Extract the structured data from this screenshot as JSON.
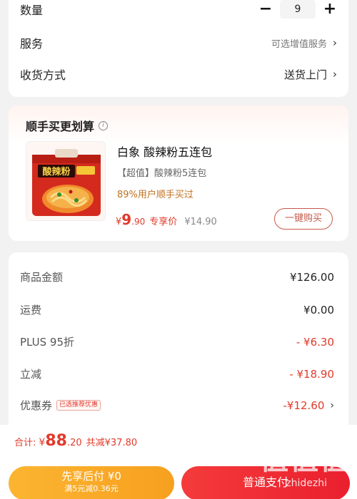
{
  "top_card": {
    "quantity_label": "数量",
    "quantity_value": "9",
    "minus_symbol": "−",
    "plus_symbol": "+",
    "service_label": "服务",
    "service_value": "可选增值服务",
    "delivery_label": "收货方式",
    "delivery_value": "送货上门",
    "chevron": "›"
  },
  "bundle": {
    "title": "顺手买更划算",
    "info_icon": "info-icon",
    "product_name": "白象 酸辣粉五连包",
    "product_sub": "【超值】酸辣粉5连包",
    "product_stat": "89%用户顺手买过",
    "currency": "¥",
    "price_int": "9",
    "price_dec": ".90",
    "exclusive_label": "专享价",
    "original_price": "¥14.90",
    "buy_button": "一键购买",
    "package_text": "酸辣粉"
  },
  "summary": {
    "rows": [
      {
        "label": "商品金额",
        "value": "¥126.00"
      },
      {
        "label": "运费",
        "value": "¥0.00"
      },
      {
        "label": "PLUS 95折",
        "value": "- ¥6.30"
      },
      {
        "label": "立减",
        "value": "- ¥18.90"
      },
      {
        "label": "优惠券",
        "tag": "已选推荐优惠",
        "value": "-¥12.60"
      }
    ]
  },
  "footer": {
    "total_label": "合计:",
    "currency": "¥",
    "total_int": "88",
    "total_dec": ".20",
    "saved": "共减¥37.80",
    "pay_later_title": "先享后付 ¥0",
    "pay_later_sub": "满5元减0.36元",
    "normal_pay": "普通支付",
    "watermark": "值值值",
    "watermark_sub": "zhidezhi"
  },
  "colors": {
    "accent_red": "#e23a2b",
    "orange_button": "#f7a01f",
    "red_button": "#ea1f2e",
    "stat_orange": "#c07020"
  }
}
